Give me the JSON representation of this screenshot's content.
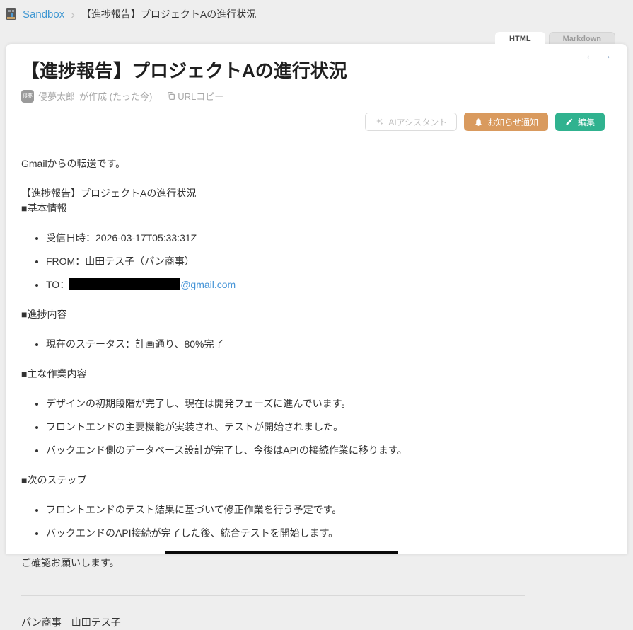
{
  "colors": {
    "brand_link_blue": "#3f97d2",
    "mail_link_blue": "#4896d8",
    "notice_button_orange": "#d99a5e",
    "edit_button_green": "#30b28f",
    "page_background_gray": "#eeeeee"
  },
  "breadcrumb": {
    "root": "Sandbox",
    "separator": "›",
    "current": "【進捗報告】プロジェクトAの進行状況"
  },
  "tabs": {
    "html_label": "HTML",
    "markdown_label": "Markdown"
  },
  "pager": {
    "back": "←",
    "forward": "→"
  },
  "header": {
    "title": "【進捗報告】プロジェクトAの進行状況",
    "avatar_text": "侵夢",
    "author_name": "侵夢太郎",
    "author_meta": "が作成 (たった今)",
    "url_copy_label": "URLコピー"
  },
  "toolbar": {
    "ai_assistant_label": "AIアシスタント",
    "notice_label": "お知らせ通知",
    "edit_label": "編集"
  },
  "article": {
    "intro": "Gmailからの転送です。",
    "subject": "【進捗報告】プロジェクトAの進行状況",
    "section_basic": "■基本情報",
    "basic_items": [
      "受信日時：2026-03-17T05:33:31Z",
      "FROM：山田テス子（パン商事）"
    ],
    "to_prefix": "TO：",
    "to_link": "@gmail.com",
    "section_progress": "■進捗内容",
    "progress_items": [
      "現在のステータス：計画通り、80%完了"
    ],
    "section_work": "■主な作業内容",
    "work_items": [
      "デザインの初期段階が完了し、現在は開発フェーズに進んでいます。",
      "フロントエンドの主要機能が実装され、テストが開始されました。",
      "バックエンド側のデータベース設計が完了し、今後はAPIの接続作業に移ります。"
    ],
    "section_next": "■次のステップ",
    "next_items": [
      "フロントエンドのテスト結果に基づいて修正作業を行う予定です。",
      "バックエンドのAPI接続が完了した後、統合テストを開始します。"
    ],
    "closing": "ご確認お願いします。",
    "signature": "パン商事　山田テス子"
  }
}
